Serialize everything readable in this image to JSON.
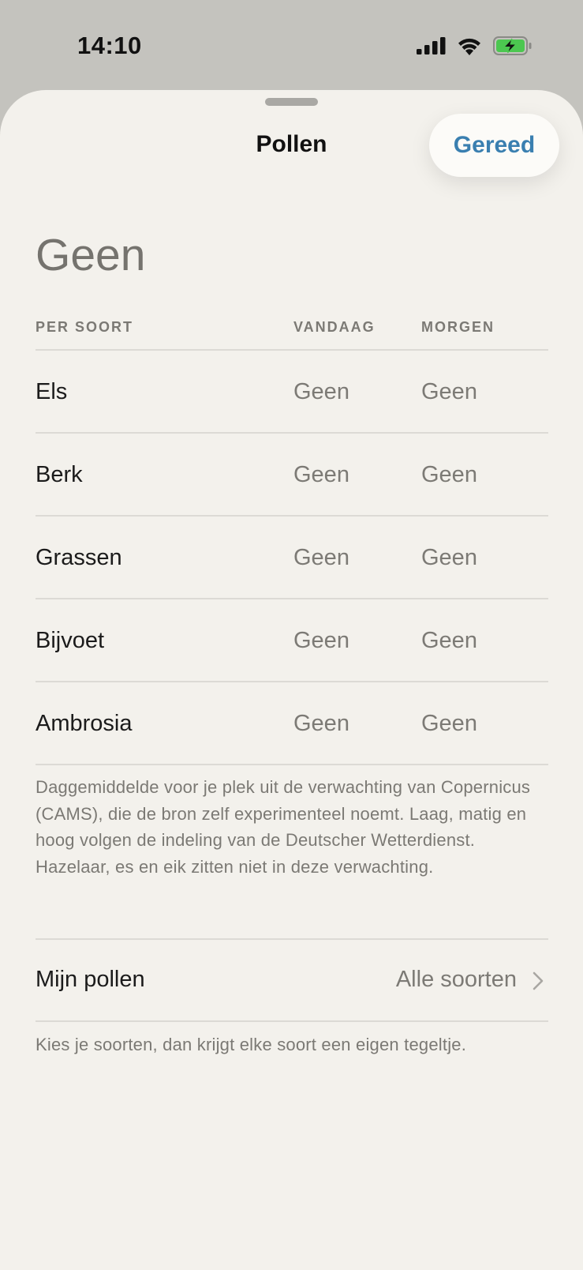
{
  "status_bar": {
    "time": "14:10",
    "icons": [
      "cellular-signal-icon",
      "wifi-icon",
      "battery-charging-icon"
    ],
    "battery_color": "#4cc750"
  },
  "sheet": {
    "title": "Pollen",
    "done_label": "Gereed",
    "accent_color": "#3a7fb0"
  },
  "summary": "Geen",
  "table": {
    "headers": {
      "name": "PER SOORT",
      "today": "VANDAAG",
      "tomorrow": "MORGEN"
    },
    "rows": [
      {
        "name": "Els",
        "today": "Geen",
        "tomorrow": "Geen"
      },
      {
        "name": "Berk",
        "today": "Geen",
        "tomorrow": "Geen"
      },
      {
        "name": "Grassen",
        "today": "Geen",
        "tomorrow": "Geen"
      },
      {
        "name": "Bijvoet",
        "today": "Geen",
        "tomorrow": "Geen"
      },
      {
        "name": "Ambrosia",
        "today": "Geen",
        "tomorrow": "Geen"
      }
    ]
  },
  "footnote": "Daggemiddelde voor je plek uit de verwachting van Copernicus (CAMS), die de bron zelf experimenteel noemt. Laag, matig en hoog volgen de indeling van de Deutscher Wetterdienst. Hazelaar, es en eik zitten niet in deze verwachting.",
  "my_pollen": {
    "label": "Mijn pollen",
    "value": "Alle soorten"
  },
  "hint": "Kies je soorten, dan krijgt elke soort een eigen tegeltje."
}
